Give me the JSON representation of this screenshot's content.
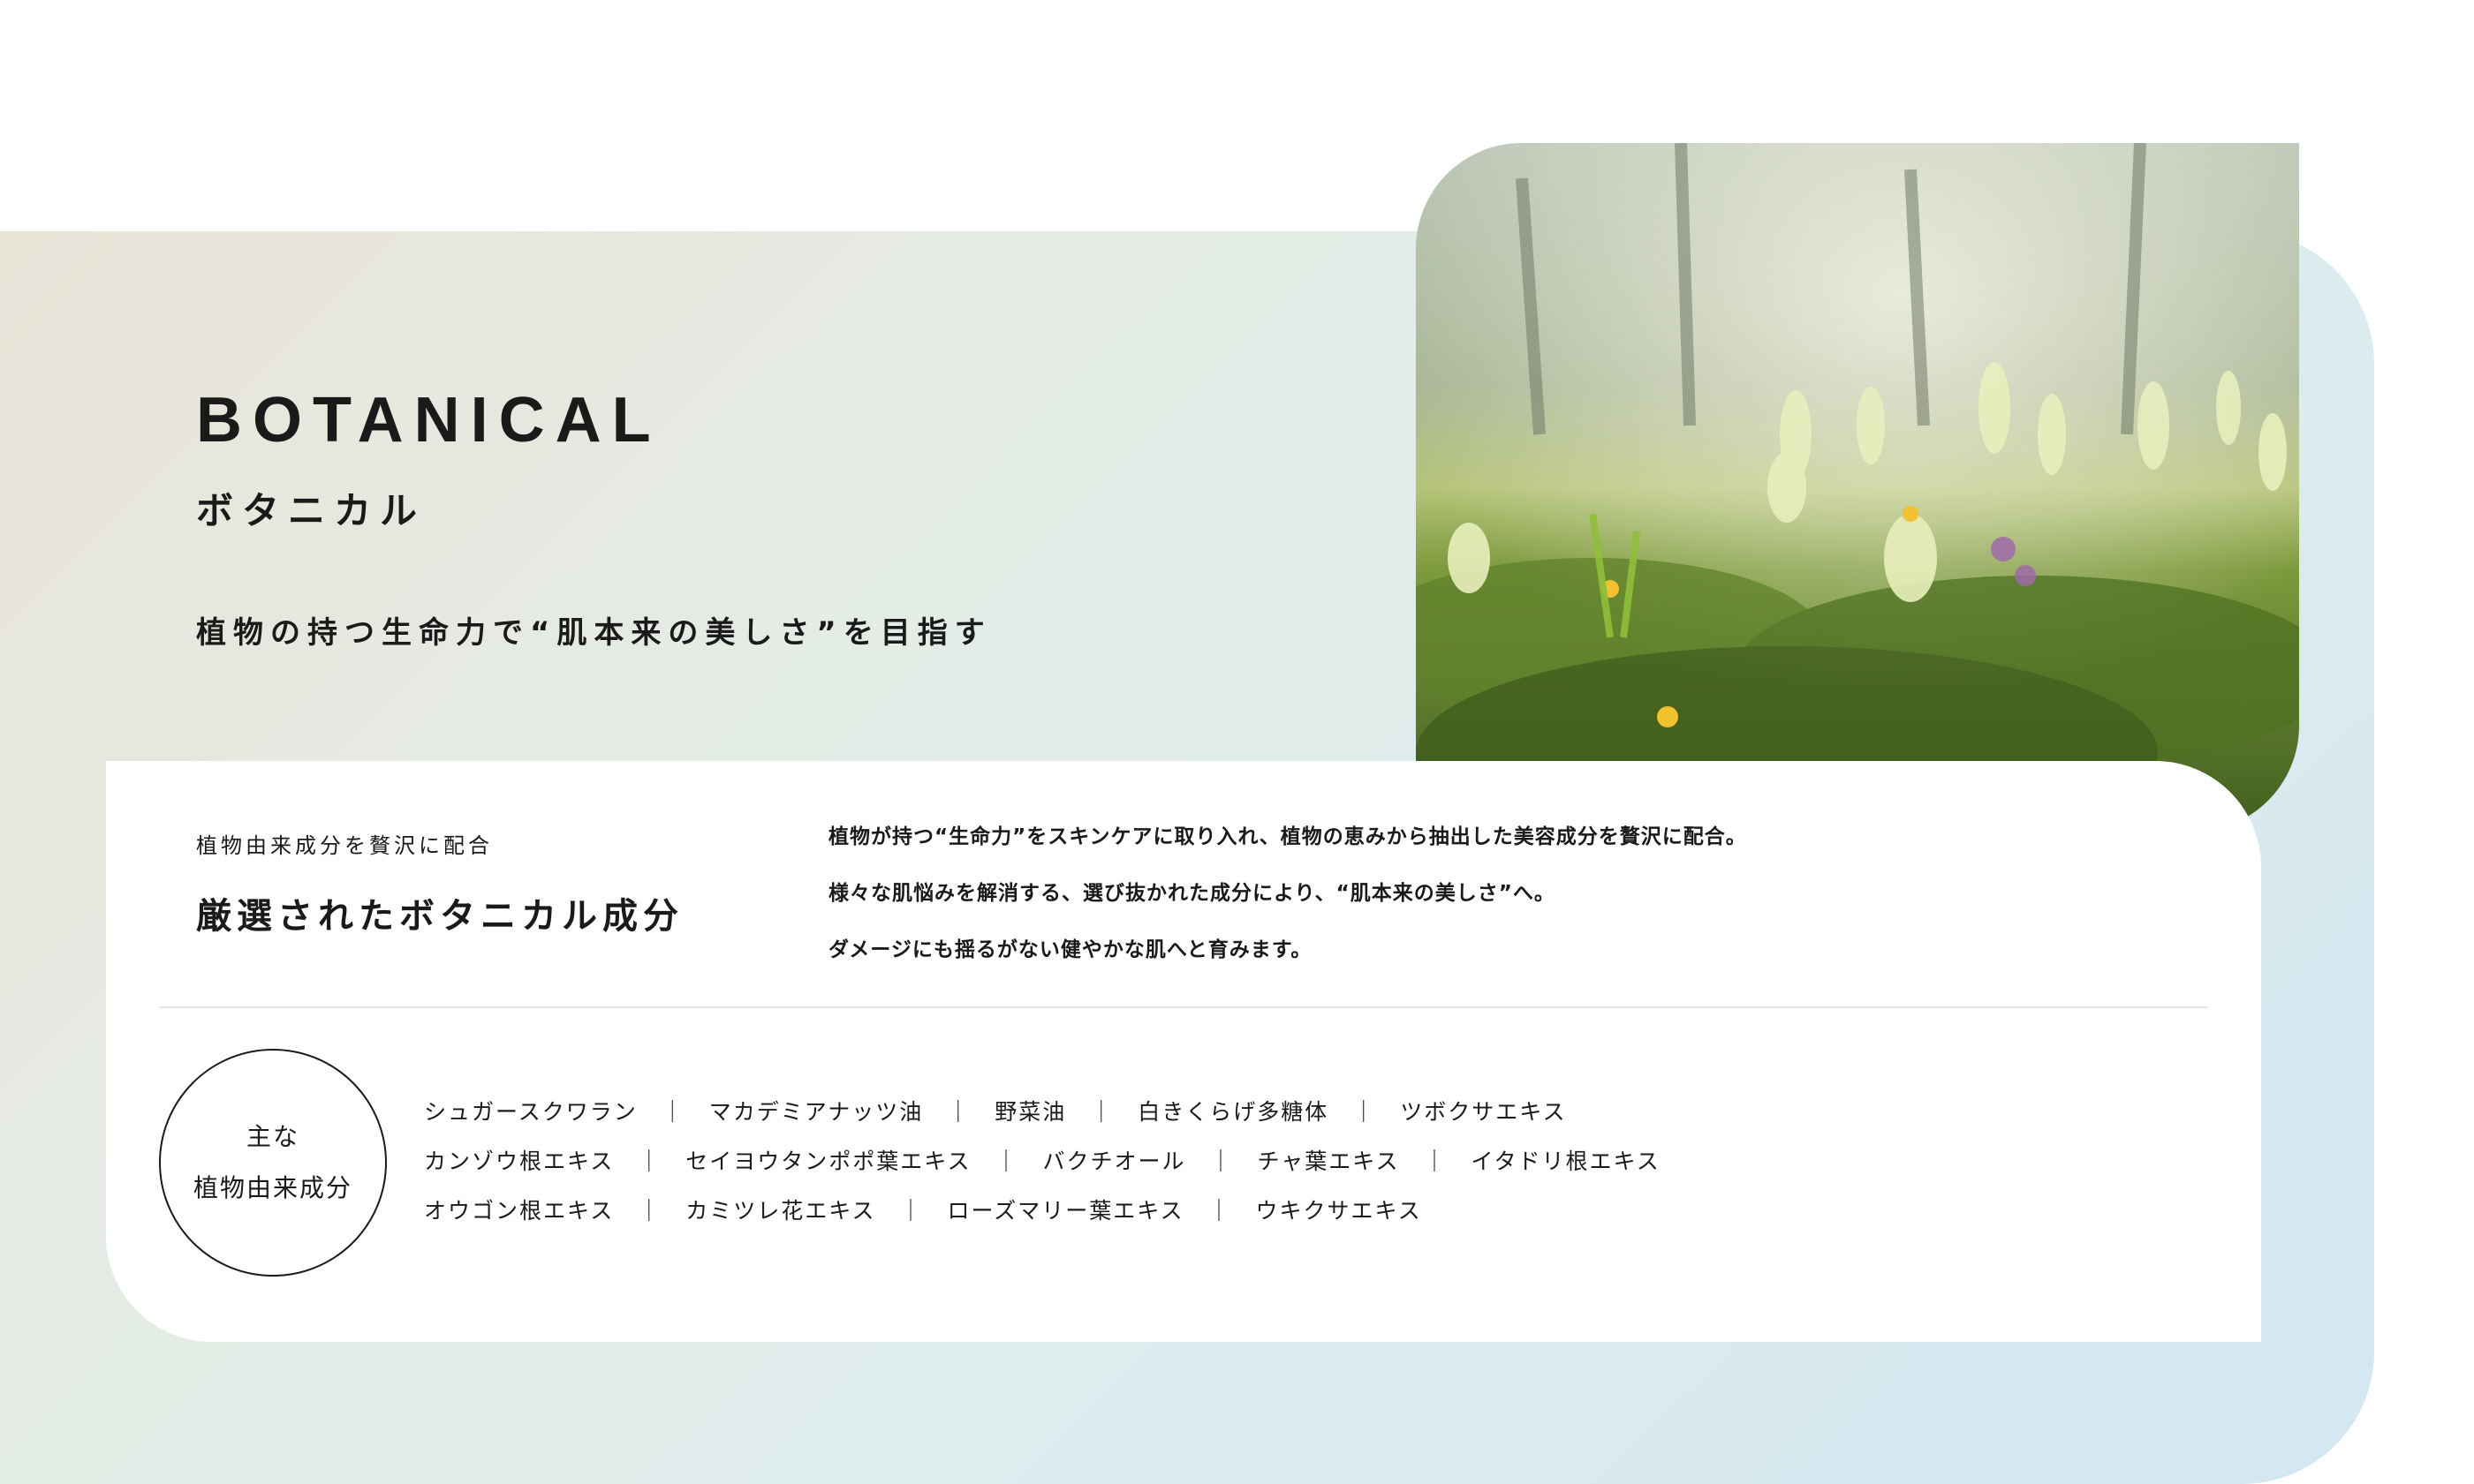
{
  "colors": {
    "text": "#1a1a1a",
    "card": "#ffffff",
    "gradient_start": "#e9e4d8",
    "gradient_end": "#d3e8f3"
  },
  "hero": {
    "title_en": "BOTANICAL",
    "title_ja": "ボタニカル",
    "tagline": "植物の持つ生命力で“肌本来の美しさ”を目指す",
    "photo": "spring-meadow-wildflowers-photo"
  },
  "card": {
    "label": "植物由来成分を贅沢に配合",
    "heading": "厳選されたボタニカル成分",
    "description": [
      "植物が持つ“生命力”をスキンケアに取り入れ、植物の恵みから抽出した美容成分を贅沢に配合。",
      "様々な肌悩みを解消する、選び抜かれた成分により、“肌本来の美しさ”へ。",
      "ダメージにも揺るがない健やかな肌へと育みます。"
    ],
    "circle": {
      "line1": "主な",
      "line2": "植物由来成分"
    },
    "ingredients": [
      "シュガースクワラン　｜　マカデミアナッツ油　｜　野菜油　｜　白きくらげ多糖体　｜　ツボクサエキス",
      "カンゾウ根エキス　｜　セイヨウタンポポ葉エキス　｜　バクチオール　｜　チャ葉エキス　｜　イタドリ根エキス",
      "オウゴン根エキス　｜　カミツレ花エキス　｜　ローズマリー葉エキス　｜　ウキクサエキス"
    ]
  }
}
